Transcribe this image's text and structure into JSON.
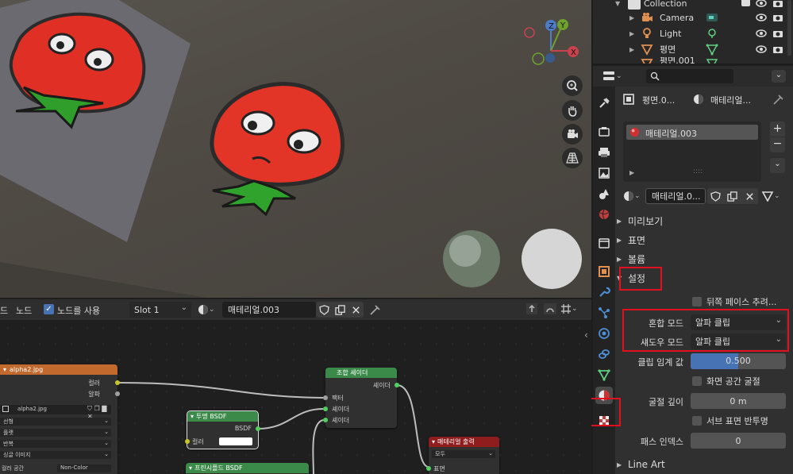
{
  "outliner": {
    "collection_label": "Collection",
    "items": [
      {
        "label": "Camera",
        "icon": "camera-object-icon",
        "data_icon": "camera-data-icon"
      },
      {
        "label": "Light",
        "icon": "light-object-icon",
        "data_icon": "light-data-icon"
      },
      {
        "label": "평면",
        "icon": "mesh-object-icon",
        "data_icon": "mesh-data-icon"
      },
      {
        "label": "평면.001",
        "icon": "mesh-object-icon",
        "data_icon": "mesh-data-icon"
      }
    ]
  },
  "properties": {
    "search_placeholder": "",
    "breadcrumb_object": "평면.0...",
    "breadcrumb_material": "매테리얼...",
    "slot_item": "매테리얼.003",
    "material_name": "매테리얼.0...",
    "panels": {
      "preview": "미리보기",
      "surface": "표면",
      "volume": "볼륨",
      "settings": "설정",
      "line_art": "Line Art"
    },
    "settings": {
      "backface_culling": "뒤쪽 페이스 추려...",
      "blend_mode_label": "혼합 모드",
      "blend_mode_value": "알파 클립",
      "shadow_mode_label": "섀도우 모드",
      "shadow_mode_value": "알파 클립",
      "clip_threshold_label": "클립 임계 값",
      "clip_threshold_value": "0.500",
      "clip_threshold_fraction": 0.5,
      "screen_space_refraction": "화면 공간 굴절",
      "refraction_depth_label": "굴절 깊이",
      "refraction_depth_value": "0 m",
      "subsurface_translucency": "서브 표면 반투명",
      "pass_index_label": "패스 인덱스",
      "pass_index_value": "0"
    }
  },
  "node_header": {
    "menu_node_partial": "드",
    "menu_node": "노드",
    "use_nodes_label": "노드를 사용",
    "slot": "Slot 1",
    "material": "매테리얼.003"
  },
  "nodes": {
    "image": {
      "title": "alpha2.jpg",
      "out_color": "컬러",
      "out_alpha": "알파",
      "image_name": "alpha2.jpg",
      "interp": "선형",
      "projection": "플랫",
      "extension": "반복",
      "source": "싱글 이미지",
      "colorspace_label": "컬러 공간",
      "colorspace_value": "Non-Color"
    },
    "mix": {
      "title": "조합 셰이더",
      "out": "셰이더",
      "in_fac": "팩터",
      "in_a": "셰이더",
      "in_b": "셰이더"
    },
    "transparent": {
      "title": "투명 BSDF",
      "out": "BSDF",
      "in_color": "컬러"
    },
    "principled": {
      "title": "프린시플드 BSDF"
    },
    "output": {
      "title": "매테리얼 출력",
      "target": "모두",
      "in_surface": "표면"
    }
  },
  "colors": {
    "accent_blue": "#4772b3",
    "highlight_red": "#e0101e",
    "node_input_orange": "#c26a2e",
    "node_shader_green": "#3b8a4a",
    "node_output_red": "#8f1d1d"
  }
}
